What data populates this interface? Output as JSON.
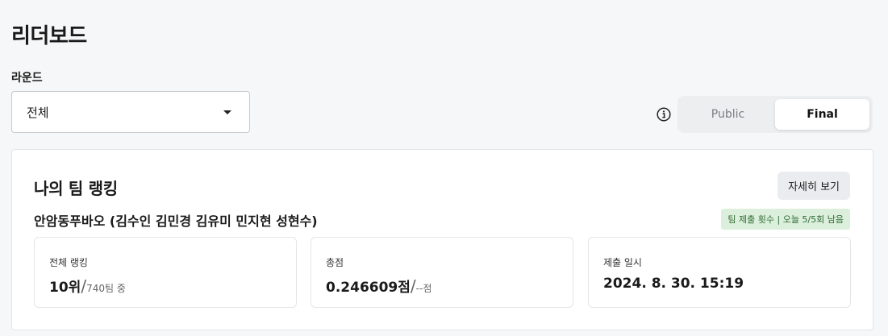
{
  "page": {
    "title": "리더보드"
  },
  "round": {
    "label": "라운드",
    "selected": "전체"
  },
  "toggle": {
    "public_label": "Public",
    "final_label": "Final",
    "active": "Final"
  },
  "card": {
    "title": "나의 팀 랭킹",
    "detail_button": "자세히 보기",
    "team_name": "안암동푸바오 (김수인 김민경 김유미 민지현 성현수)",
    "quota_badge": "팀 제출 횟수 | 오늘 5/5회 남음",
    "stats": {
      "rank": {
        "label": "전체 랭킹",
        "value": "10위",
        "slash": "/",
        "sub": "740팀 중"
      },
      "score": {
        "label": "총점",
        "value": "0.246609점",
        "slash": "/",
        "sub": "--점"
      },
      "submitted": {
        "label": "제출 일시",
        "value": "2024. 8. 30. 15:19"
      }
    }
  },
  "colors": {
    "badge_bg": "#dcefdc",
    "badge_text": "#2f6b33",
    "page_bg": "#f6f7f8"
  },
  "icons": {
    "info": "info-circle-icon",
    "dropdown": "caret-down-icon"
  }
}
